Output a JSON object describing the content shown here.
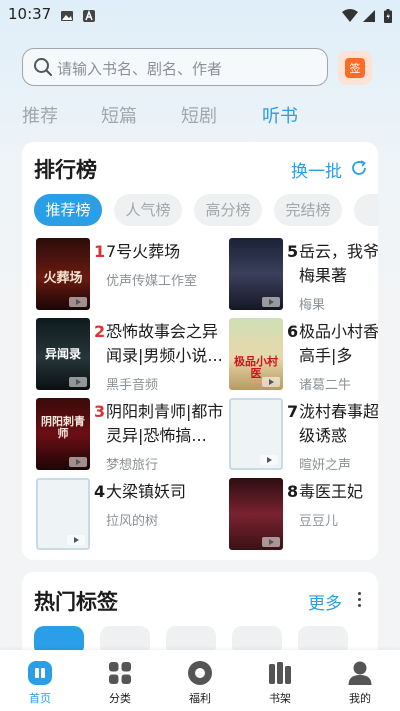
{
  "status_bar": {
    "time": "10:37"
  },
  "search": {
    "placeholder": "请输入书名、剧名、作者"
  },
  "sign_button": {
    "label": "签"
  },
  "top_tabs": [
    {
      "label": "推荐"
    },
    {
      "label": "短篇"
    },
    {
      "label": "短剧"
    },
    {
      "label": "听书",
      "active": true
    }
  ],
  "ranking": {
    "title": "排行榜",
    "swap_label": "换一批",
    "chips": [
      {
        "label": "推荐榜",
        "active": true
      },
      {
        "label": "人气榜"
      },
      {
        "label": "高分榜"
      },
      {
        "label": "完结榜"
      },
      {
        "label": ""
      }
    ],
    "books": [
      {
        "rank": "1",
        "title": "7号火葬场",
        "author": "优声传媒工作室",
        "cover_text": "火葬场"
      },
      {
        "rank": "2",
        "title": "恐怖故事会之异闻录|男频小说...",
        "author": "黑手音频",
        "cover_text": "异闻录"
      },
      {
        "rank": "3",
        "title": "阴阳刺青师|都市灵异|恐怖搞...",
        "author": "梦想旅行",
        "cover_text": "阴阳刺青师"
      },
      {
        "rank": "4",
        "title": "大梁镇妖司",
        "author": "拉风的树",
        "cover_text": ""
      },
      {
        "rank": "5",
        "title": "岳云，我爷|梅果著",
        "author": "梅果",
        "cover_text": ""
      },
      {
        "rank": "6",
        "title": "极品小村香高手|多",
        "author": "诸葛二牛",
        "cover_text": "极品小村医"
      },
      {
        "rank": "7",
        "title": "泷村春事超级诱惑",
        "author": "暄妍之声",
        "cover_text": ""
      },
      {
        "rank": "8",
        "title": "毒医王妃",
        "author": "豆豆儿",
        "cover_text": ""
      }
    ]
  },
  "tags": {
    "title": "热门标签",
    "more_label": "更多"
  },
  "bottom_nav": [
    {
      "label": "首页",
      "icon": "home-icon",
      "active": true
    },
    {
      "label": "分类",
      "icon": "category-icon"
    },
    {
      "label": "福利",
      "icon": "welfare-icon"
    },
    {
      "label": "书架",
      "icon": "bookshelf-icon"
    },
    {
      "label": "我的",
      "icon": "profile-icon"
    }
  ],
  "colors": {
    "accent": "#2a9ee6",
    "rank_red": "#e03131",
    "sign_orange": "#ff6b22"
  }
}
